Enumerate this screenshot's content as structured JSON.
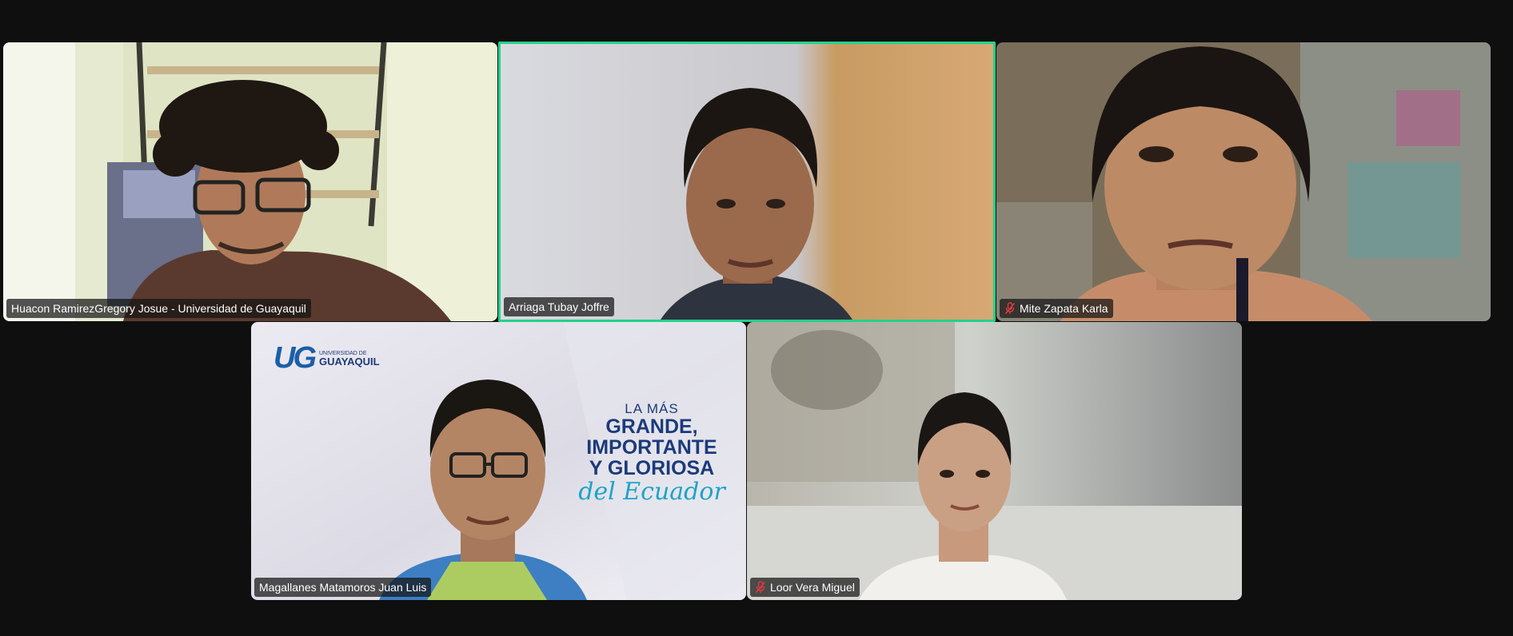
{
  "participants": [
    {
      "name": "Huacon RamirezGregory Josue - Universidad de Guayaquil",
      "muted": false,
      "active_speaker": false
    },
    {
      "name": "Arriaga Tubay Joffre",
      "muted": false,
      "active_speaker": true
    },
    {
      "name": "Mite Zapata Karla",
      "muted": true,
      "active_speaker": false
    },
    {
      "name": "Magallanes Matamoros Juan Luis",
      "muted": false,
      "active_speaker": false
    },
    {
      "name": "Loor Vera Miguel",
      "muted": true,
      "active_speaker": false
    }
  ],
  "virtual_background": {
    "logo_letters": "UG",
    "logo_line1": "UNIVERSIDAD DE",
    "logo_line2": "GUAYAQUIL",
    "slogan_small": "LA MÁS",
    "slogan_line1": "GRANDE,",
    "slogan_line2": "IMPORTANTE",
    "slogan_line3": "Y GLORIOSA",
    "slogan_script": "del Ecuador"
  },
  "colors": {
    "background": "#0f0f0f",
    "active_speaker_border": "#23d18b",
    "mute_icon": "#e0393e"
  },
  "icons": {
    "muted": "microphone-muted-icon"
  }
}
